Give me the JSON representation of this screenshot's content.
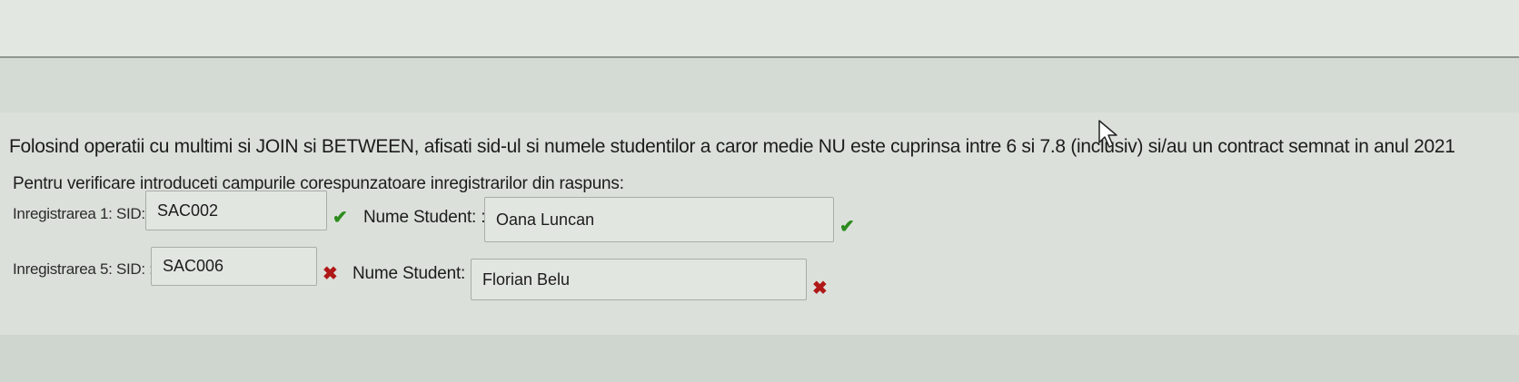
{
  "question": {
    "text": "Folosind operatii cu multimi si JOIN si BETWEEN, afisati sid-ul si numele studentilor a caror medie NU este cuprinsa intre 6 si 7.8 (inclusiv) si/au un contract semnat in anul 2021"
  },
  "instruction": {
    "text": "Pentru verificare introduceti campurile corespunzatoare inregistrarilor din raspuns:"
  },
  "rows": [
    {
      "label": "Inregistrarea 1: SID: :",
      "sid_value": "SAC002",
      "sid_status": "correct",
      "name_label": "Nume Student: :",
      "name_value": "Oana Luncan",
      "name_status": "correct"
    },
    {
      "label": "Inregistrarea 5: SID: :",
      "sid_value": "SAC006",
      "sid_status": "incorrect",
      "name_label": "Nume Student: :",
      "name_value": "Florian Belu",
      "name_status": "incorrect"
    }
  ],
  "icons": {
    "correct": "✔",
    "incorrect": "✖",
    "correct_icon_name": "checkmark-icon",
    "incorrect_icon_name": "cross-icon",
    "cursor_icon_name": "mouse-cursor-icon"
  },
  "colors": {
    "correct": "#2e8b1e",
    "incorrect": "#b01818"
  }
}
